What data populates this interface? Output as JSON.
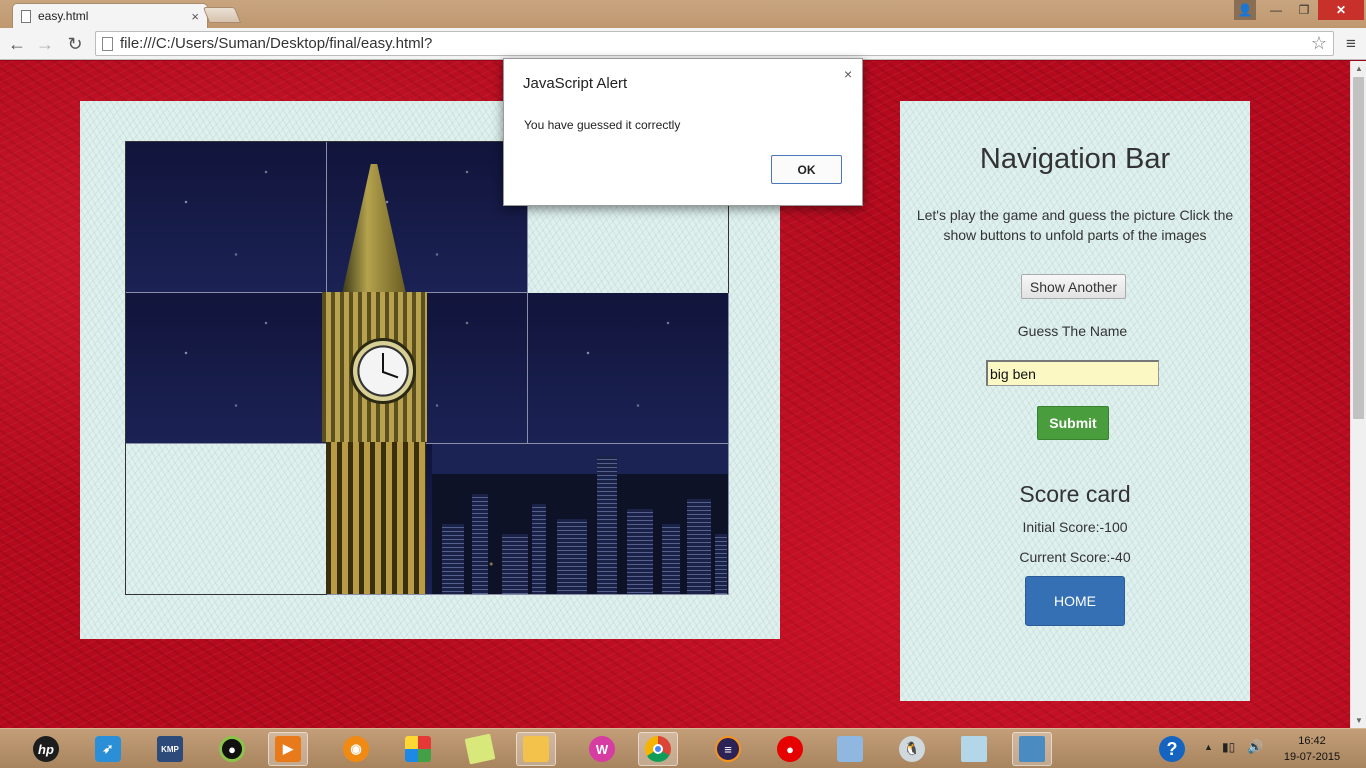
{
  "browser": {
    "tab_title": "easy.html",
    "tab_close": "×",
    "url": "file:///C:/Users/Suman/Desktop/final/easy.html?"
  },
  "window_controls": {
    "minimize": "—",
    "maximize": "❐",
    "close": "✕"
  },
  "nav_panel": {
    "title": "Navigation Bar",
    "description": "Let's play the game and guess the picture Click the show buttons to unfold parts of the images",
    "show_button": "Show Another",
    "guess_label": "Guess The Name",
    "guess_value": "big ben",
    "submit_button": "Submit",
    "score_title": "Score card",
    "initial_score": "Initial Score:-100",
    "current_score": "Current Score:-40",
    "home_button": "HOME"
  },
  "puzzle": {
    "grid": "3x3",
    "hidden_tiles": [
      2,
      6
    ],
    "image": "Big Ben at night"
  },
  "alert": {
    "title": "JavaScript Alert",
    "close": "×",
    "message": "You have guessed it correctly",
    "ok_button": "OK"
  },
  "taskbar": {
    "icons": [
      "hp-icon",
      "rocket-icon",
      "kmplayer-icon",
      "camera-icon",
      "media-player-icon",
      "vlc-icon",
      "puzzle-app-icon",
      "notes-icon",
      "file-explorer-icon",
      "winamp-icon",
      "chrome-icon",
      "eclipse-icon",
      "vodafone-icon",
      "box-icon",
      "penguin-icon",
      "paper-icon",
      "photo-viewer-icon",
      "help-icon"
    ],
    "time": "16:42",
    "date": "19-07-2015"
  },
  "colors": {
    "background_red": "#b50a1e",
    "submit_green": "#4a9d3d",
    "home_blue": "#3470b3",
    "input_yellow": "#fbf8c4"
  }
}
